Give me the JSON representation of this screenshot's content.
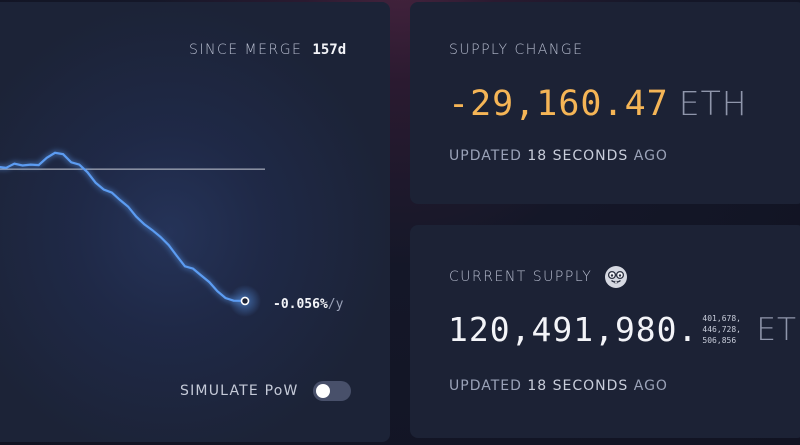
{
  "chart_card": {
    "since_merge_label": "SINCE MERGE",
    "since_merge_value": "157d",
    "rate_value": "-0.056%",
    "rate_unit": "/y",
    "simulate_label": "SIMULATE PoW",
    "simulate_pow_on": false,
    "line_color": "#5b9cf2"
  },
  "chart_data": {
    "type": "line",
    "title": "",
    "xlabel": "",
    "ylabel": "",
    "x_days": [
      0,
      5,
      10,
      15,
      20,
      25,
      30,
      35,
      40,
      45,
      50,
      55,
      60,
      65,
      70,
      75,
      80,
      85,
      90,
      95,
      100,
      105,
      110,
      115,
      120,
      125,
      130,
      135,
      140,
      145,
      150,
      157
    ],
    "series": [
      {
        "values": [
          -300,
          500,
          300,
          1200,
          800,
          1000,
          900,
          2500,
          3600,
          3300,
          1500,
          1000,
          -700,
          -3000,
          -4500,
          -5200,
          -6800,
          -8300,
          -10500,
          -12200,
          -13500,
          -15000,
          -16800,
          -19200,
          -21500,
          -22000,
          -23500,
          -25000,
          -27000,
          -28500,
          -29100,
          -29160
        ]
      }
    ],
    "baseline_value": 0,
    "ylim": [
      -30500,
      6000
    ]
  },
  "supply_change": {
    "title": "SUPPLY CHANGE",
    "value": "-29,160.47",
    "unit": "ETH",
    "updated_prefix": "UPDATED",
    "updated_time": "18 SECONDS",
    "updated_suffix": "AGO"
  },
  "current_supply": {
    "title": "CURRENT SUPPLY",
    "icon": "nerd-face-icon",
    "value": "120,491,980.",
    "decimals_line1": "401,678,",
    "decimals_line2": "446,728,",
    "decimals_line3": "506,856",
    "unit": "ETH",
    "updated_prefix": "UPDATED",
    "updated_time": "18 SECONDS",
    "updated_suffix": "AGO"
  }
}
